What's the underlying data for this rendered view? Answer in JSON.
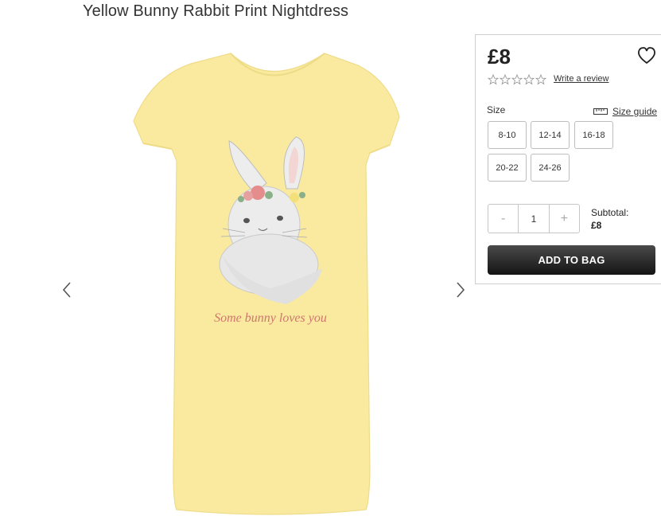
{
  "product": {
    "title": "Yellow Bunny Rabbit Print Nightdress",
    "print_text": "Some bunny loves you",
    "dress_color": "#f9eaa0",
    "print_text_color": "#d0766e"
  },
  "panel": {
    "price": "£8",
    "write_review": "Write a review",
    "rating": 0,
    "size_label": "Size",
    "size_guide_label": "Size guide",
    "sizes": [
      "8-10",
      "12-14",
      "16-18",
      "20-22",
      "24-26"
    ],
    "quantity": {
      "minus": "-",
      "value": "1",
      "plus": "+"
    },
    "subtotal_label": "Subtotal:",
    "subtotal_value": "£8",
    "add_to_bag": "ADD TO BAG",
    "button_color": "#1f1f1f"
  },
  "icons": {
    "prev": "chevron-left-icon",
    "next": "chevron-right-icon",
    "wishlist": "heart-icon",
    "stars": "star-outline-icon",
    "size_guide": "ruler-icon"
  }
}
